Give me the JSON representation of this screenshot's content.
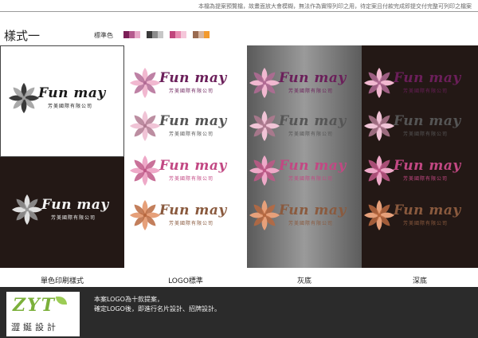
{
  "header": {
    "notice": "本檔為提案預覽檔，故畫面放大會模糊，無法作為實際列印之用，待定案且付款完成即提交付完整可列印之檔案",
    "section_title": "樣式一",
    "swatch_label": "標準色"
  },
  "swatch_groups": [
    [
      "#7b1f57",
      "#b55a8e",
      "#e7a8c8"
    ],
    [
      "#3a3a3a",
      "#8b8b8b",
      "#c7c7c7"
    ],
    [
      "#c0457c",
      "#e88bb1",
      "#f5c7da"
    ],
    [
      "#9a6b50",
      "#d7b59e",
      "#f39b2e"
    ]
  ],
  "brand": {
    "name": "Fun may",
    "subtitle": "芳美國際有限公司"
  },
  "columns": [
    {
      "caption": "單色印刷樣式"
    },
    {
      "caption": "LOGO標準"
    },
    {
      "caption": "灰底"
    },
    {
      "caption": "深底"
    }
  ],
  "footer": {
    "logo_mark": "ZYT",
    "logo_text": "澀娫設計",
    "note_line1": "本案LOGO為十款提案，",
    "note_line2": "確定LOGO後，即進行名片設計、招牌設計。"
  },
  "logo_variants": [
    {
      "name": "purple",
      "petal": "#f1b8d0",
      "center": "#b36b95",
      "text": "#6b1f5a"
    },
    {
      "name": "gray",
      "petal": "#f0c4d6",
      "center": "#b07a90",
      "text": "#555555"
    },
    {
      "name": "pink",
      "petal": "#eea9c8",
      "center": "#c05887",
      "text": "#c24883"
    },
    {
      "name": "copper",
      "petal": "#e6a07a",
      "center": "#b8683f",
      "text": "#8a5a3e"
    }
  ],
  "mono_variants": [
    {
      "name": "mono-dark",
      "petal": "#3a3a3a",
      "center": "#9a9a9a",
      "text": "#1a1a1a"
    },
    {
      "name": "mono-light",
      "petal": "#e0e0e0",
      "center": "#9a9a9a",
      "text": "#f2f2f2"
    }
  ]
}
